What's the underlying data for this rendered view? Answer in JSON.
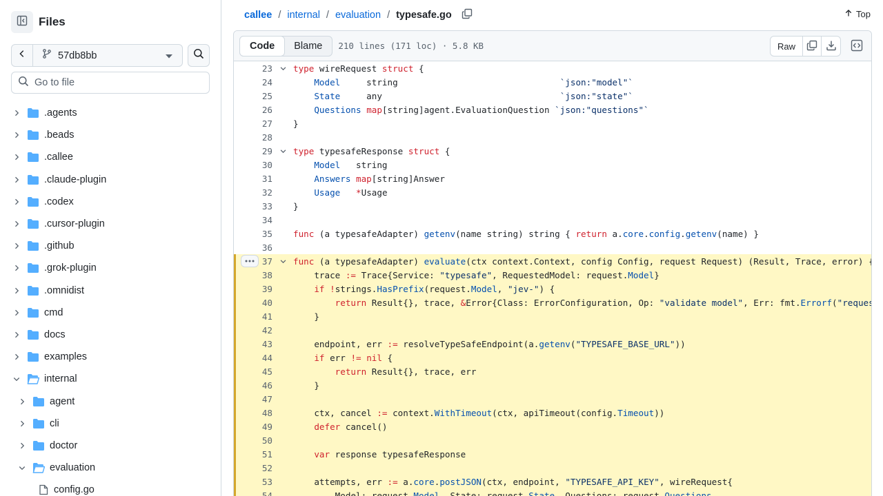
{
  "sidebar": {
    "title": "Files",
    "branch": "57db8bb",
    "goto_placeholder": "Go to file",
    "items": [
      {
        "label": ".agents",
        "depth": 0,
        "expanded": false,
        "kind": "folder"
      },
      {
        "label": ".beads",
        "depth": 0,
        "expanded": false,
        "kind": "folder"
      },
      {
        "label": ".callee",
        "depth": 0,
        "expanded": false,
        "kind": "folder"
      },
      {
        "label": ".claude-plugin",
        "depth": 0,
        "expanded": false,
        "kind": "folder"
      },
      {
        "label": ".codex",
        "depth": 0,
        "expanded": false,
        "kind": "folder"
      },
      {
        "label": ".cursor-plugin",
        "depth": 0,
        "expanded": false,
        "kind": "folder"
      },
      {
        "label": ".github",
        "depth": 0,
        "expanded": false,
        "kind": "folder"
      },
      {
        "label": ".grok-plugin",
        "depth": 0,
        "expanded": false,
        "kind": "folder"
      },
      {
        "label": ".omnidist",
        "depth": 0,
        "expanded": false,
        "kind": "folder"
      },
      {
        "label": "cmd",
        "depth": 0,
        "expanded": false,
        "kind": "folder"
      },
      {
        "label": "docs",
        "depth": 0,
        "expanded": false,
        "kind": "folder"
      },
      {
        "label": "examples",
        "depth": 0,
        "expanded": false,
        "kind": "folder"
      },
      {
        "label": "internal",
        "depth": 0,
        "expanded": true,
        "kind": "folder"
      },
      {
        "label": "agent",
        "depth": 1,
        "expanded": false,
        "kind": "folder"
      },
      {
        "label": "cli",
        "depth": 1,
        "expanded": false,
        "kind": "folder"
      },
      {
        "label": "doctor",
        "depth": 1,
        "expanded": false,
        "kind": "folder"
      },
      {
        "label": "evaluation",
        "depth": 1,
        "expanded": true,
        "kind": "folder"
      },
      {
        "label": "config.go",
        "depth": 2,
        "expanded": false,
        "kind": "file"
      }
    ]
  },
  "breadcrumb": {
    "repo": "callee",
    "sep": "/",
    "parts": [
      "internal",
      "evaluation"
    ],
    "file": "typesafe.go"
  },
  "top_label": "Top",
  "file_header": {
    "tab_code": "Code",
    "tab_blame": "Blame",
    "meta": "210 lines (171 loc) · 5.8 KB",
    "raw_label": "Raw"
  },
  "icons": {
    "panel": "sidebar-collapse-icon",
    "back": "chevron-left-icon",
    "branch": "git-branch-icon",
    "caret": "triangle-down-icon",
    "search": "search-icon",
    "folder": "folder-icon",
    "file": "file-icon",
    "copy": "copy-icon",
    "download": "download-icon",
    "symbols": "code-square-icon",
    "arrow_up": "arrow-up-icon",
    "kebab": "kebab-horizontal-icon"
  },
  "colors": {
    "link": "#0969da",
    "keyword": "#cf222e",
    "entity": "#0550ae",
    "string": "#0a3069",
    "highlight_bg": "#fff8c5",
    "highlight_bar": "#d4a72c",
    "folder": "#54aeff"
  },
  "code": {
    "lines": [
      {
        "n": "23",
        "fold": true,
        "hl": false,
        "tokens": [
          [
            "kw",
            "type"
          ],
          [
            "pl",
            " wireRequest "
          ],
          [
            "kw",
            "struct"
          ],
          [
            "pl",
            " {"
          ]
        ]
      },
      {
        "n": "24",
        "fold": false,
        "hl": false,
        "tokens": [
          [
            "pl",
            "    "
          ],
          [
            "fn",
            "Model"
          ],
          [
            "pl",
            "     string                               "
          ],
          [
            "str",
            "`json:\"model\"`"
          ]
        ]
      },
      {
        "n": "25",
        "fold": false,
        "hl": false,
        "tokens": [
          [
            "pl",
            "    "
          ],
          [
            "fn",
            "State"
          ],
          [
            "pl",
            "     any                                  "
          ],
          [
            "str",
            "`json:\"state\"`"
          ]
        ]
      },
      {
        "n": "26",
        "fold": false,
        "hl": false,
        "tokens": [
          [
            "pl",
            "    "
          ],
          [
            "fn",
            "Questions"
          ],
          [
            "pl",
            " "
          ],
          [
            "kw",
            "map"
          ],
          [
            "pl",
            "[string]agent.EvaluationQuestion "
          ],
          [
            "str",
            "`json:\"questions\"`"
          ]
        ]
      },
      {
        "n": "27",
        "fold": false,
        "hl": false,
        "tokens": [
          [
            "pl",
            "}"
          ]
        ]
      },
      {
        "n": "28",
        "fold": false,
        "hl": false,
        "tokens": []
      },
      {
        "n": "29",
        "fold": true,
        "hl": false,
        "tokens": [
          [
            "kw",
            "type"
          ],
          [
            "pl",
            " typesafeResponse "
          ],
          [
            "kw",
            "struct"
          ],
          [
            "pl",
            " {"
          ]
        ]
      },
      {
        "n": "30",
        "fold": false,
        "hl": false,
        "tokens": [
          [
            "pl",
            "    "
          ],
          [
            "fn",
            "Model"
          ],
          [
            "pl",
            "   string"
          ]
        ]
      },
      {
        "n": "31",
        "fold": false,
        "hl": false,
        "tokens": [
          [
            "pl",
            "    "
          ],
          [
            "fn",
            "Answers"
          ],
          [
            "pl",
            " "
          ],
          [
            "kw",
            "map"
          ],
          [
            "pl",
            "[string]Answer"
          ]
        ]
      },
      {
        "n": "32",
        "fold": false,
        "hl": false,
        "tokens": [
          [
            "pl",
            "    "
          ],
          [
            "fn",
            "Usage"
          ],
          [
            "pl",
            "   "
          ],
          [
            "kw",
            "*"
          ],
          [
            "pl",
            "Usage"
          ]
        ]
      },
      {
        "n": "33",
        "fold": false,
        "hl": false,
        "tokens": [
          [
            "pl",
            "}"
          ]
        ]
      },
      {
        "n": "34",
        "fold": false,
        "hl": false,
        "tokens": []
      },
      {
        "n": "35",
        "fold": false,
        "hl": false,
        "tokens": [
          [
            "kw",
            "func"
          ],
          [
            "pl",
            " (a typesafeAdapter) "
          ],
          [
            "fn",
            "getenv"
          ],
          [
            "pl",
            "(name string) string { "
          ],
          [
            "kw",
            "return"
          ],
          [
            "pl",
            " a."
          ],
          [
            "fn",
            "core"
          ],
          [
            "pl",
            "."
          ],
          [
            "fn",
            "config"
          ],
          [
            "pl",
            "."
          ],
          [
            "fn",
            "getenv"
          ],
          [
            "pl",
            "(name) }"
          ]
        ]
      },
      {
        "n": "36",
        "fold": false,
        "hl": false,
        "tokens": []
      },
      {
        "n": "37",
        "fold": true,
        "hl": true,
        "more": true,
        "tokens": [
          [
            "kw",
            "func"
          ],
          [
            "pl",
            " (a typesafeAdapter) "
          ],
          [
            "fn",
            "evaluate"
          ],
          [
            "pl",
            "(ctx context.Context, config Config, request Request) (Result, Trace, error) {"
          ]
        ]
      },
      {
        "n": "38",
        "fold": false,
        "hl": true,
        "tokens": [
          [
            "pl",
            "    trace "
          ],
          [
            "kw",
            ":="
          ],
          [
            "pl",
            " Trace{Service: "
          ],
          [
            "str",
            "\"typesafe\""
          ],
          [
            "pl",
            ", RequestedModel: request."
          ],
          [
            "fn",
            "Model"
          ],
          [
            "pl",
            "}"
          ]
        ]
      },
      {
        "n": "39",
        "fold": false,
        "hl": true,
        "tokens": [
          [
            "pl",
            "    "
          ],
          [
            "kw",
            "if"
          ],
          [
            "pl",
            " "
          ],
          [
            "kw",
            "!"
          ],
          [
            "pl",
            "strings."
          ],
          [
            "fn",
            "HasPrefix"
          ],
          [
            "pl",
            "(request."
          ],
          [
            "fn",
            "Model"
          ],
          [
            "pl",
            ", "
          ],
          [
            "str",
            "\"jev-\""
          ],
          [
            "pl",
            ") {"
          ]
        ]
      },
      {
        "n": "40",
        "fold": false,
        "hl": true,
        "tokens": [
          [
            "pl",
            "        "
          ],
          [
            "kw",
            "return"
          ],
          [
            "pl",
            " Result{}, trace, "
          ],
          [
            "kw",
            "&"
          ],
          [
            "pl",
            "Error{Class: ErrorConfiguration, Op: "
          ],
          [
            "str",
            "\"validate model\""
          ],
          [
            "pl",
            ", Err: fmt."
          ],
          [
            "fn",
            "Errorf"
          ],
          [
            "pl",
            "("
          ],
          [
            "str",
            "\"requested m"
          ]
        ]
      },
      {
        "n": "41",
        "fold": false,
        "hl": true,
        "tokens": [
          [
            "pl",
            "    }"
          ]
        ]
      },
      {
        "n": "42",
        "fold": false,
        "hl": true,
        "tokens": []
      },
      {
        "n": "43",
        "fold": false,
        "hl": true,
        "tokens": [
          [
            "pl",
            "    endpoint, err "
          ],
          [
            "kw",
            ":="
          ],
          [
            "pl",
            " resolveTypeSafeEndpoint(a."
          ],
          [
            "fn",
            "getenv"
          ],
          [
            "pl",
            "("
          ],
          [
            "str",
            "\"TYPESAFE_BASE_URL\""
          ],
          [
            "pl",
            "))"
          ]
        ]
      },
      {
        "n": "44",
        "fold": false,
        "hl": true,
        "tokens": [
          [
            "pl",
            "    "
          ],
          [
            "kw",
            "if"
          ],
          [
            "pl",
            " err "
          ],
          [
            "kw",
            "!="
          ],
          [
            "pl",
            " "
          ],
          [
            "kw",
            "nil"
          ],
          [
            "pl",
            " {"
          ]
        ]
      },
      {
        "n": "45",
        "fold": false,
        "hl": true,
        "tokens": [
          [
            "pl",
            "        "
          ],
          [
            "kw",
            "return"
          ],
          [
            "pl",
            " Result{}, trace, err"
          ]
        ]
      },
      {
        "n": "46",
        "fold": false,
        "hl": true,
        "tokens": [
          [
            "pl",
            "    }"
          ]
        ]
      },
      {
        "n": "47",
        "fold": false,
        "hl": true,
        "tokens": []
      },
      {
        "n": "48",
        "fold": false,
        "hl": true,
        "tokens": [
          [
            "pl",
            "    ctx, cancel "
          ],
          [
            "kw",
            ":="
          ],
          [
            "pl",
            " context."
          ],
          [
            "fn",
            "WithTimeout"
          ],
          [
            "pl",
            "(ctx, apiTimeout(config."
          ],
          [
            "fn",
            "Timeout"
          ],
          [
            "pl",
            "))"
          ]
        ]
      },
      {
        "n": "49",
        "fold": false,
        "hl": true,
        "tokens": [
          [
            "pl",
            "    "
          ],
          [
            "kw",
            "defer"
          ],
          [
            "pl",
            " cancel()"
          ]
        ]
      },
      {
        "n": "50",
        "fold": false,
        "hl": true,
        "tokens": []
      },
      {
        "n": "51",
        "fold": false,
        "hl": true,
        "tokens": [
          [
            "pl",
            "    "
          ],
          [
            "kw",
            "var"
          ],
          [
            "pl",
            " response typesafeResponse"
          ]
        ]
      },
      {
        "n": "52",
        "fold": false,
        "hl": true,
        "tokens": []
      },
      {
        "n": "53",
        "fold": false,
        "hl": true,
        "tokens": [
          [
            "pl",
            "    attempts, err "
          ],
          [
            "kw",
            ":="
          ],
          [
            "pl",
            " a."
          ],
          [
            "fn",
            "core"
          ],
          [
            "pl",
            "."
          ],
          [
            "fn",
            "postJSON"
          ],
          [
            "pl",
            "(ctx, endpoint, "
          ],
          [
            "str",
            "\"TYPESAFE_API_KEY\""
          ],
          [
            "pl",
            ", wireRequest{"
          ]
        ]
      },
      {
        "n": "54",
        "fold": false,
        "hl": true,
        "tokens": [
          [
            "pl",
            "        Model: request."
          ],
          [
            "fn",
            "Model"
          ],
          [
            "pl",
            ", State: request."
          ],
          [
            "fn",
            "State"
          ],
          [
            "pl",
            ", Questions: request."
          ],
          [
            "fn",
            "Questions"
          ],
          [
            "pl",
            ","
          ]
        ]
      }
    ]
  }
}
